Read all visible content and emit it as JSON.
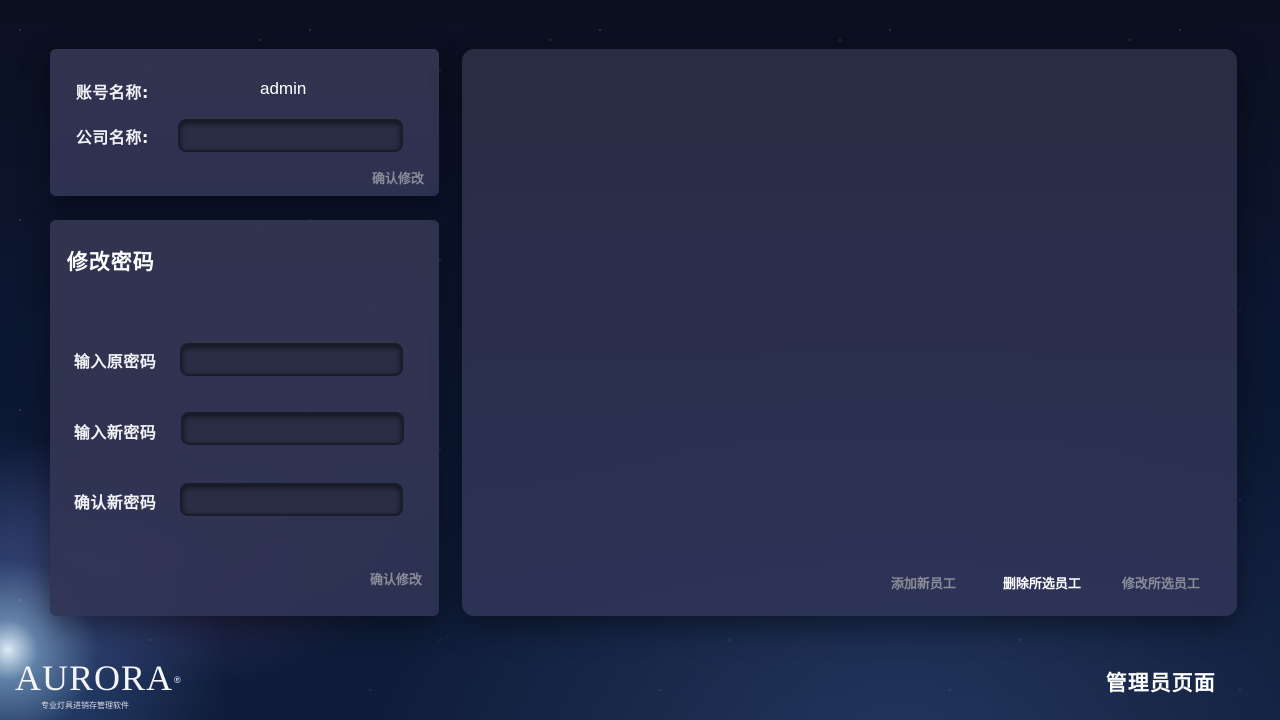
{
  "account": {
    "account_name_label": "账号名称:",
    "account_name_value": "admin",
    "company_name_label": "公司名称:",
    "company_name_value": "",
    "confirm_label": "确认修改"
  },
  "password": {
    "title": "修改密码",
    "old_label": "输入原密码",
    "new_label": "输入新密码",
    "confirm_new_label": "确认新密码",
    "confirm_label": "确认修改"
  },
  "staff": {
    "add_label": "添加新员工",
    "delete_label": "删除所选员工",
    "edit_label": "修改所选员工"
  },
  "branding": {
    "logo_text": "AURORA",
    "logo_mark": "®",
    "tagline": "专业灯具进销存管理软件"
  },
  "page_title": "管理员页面"
}
